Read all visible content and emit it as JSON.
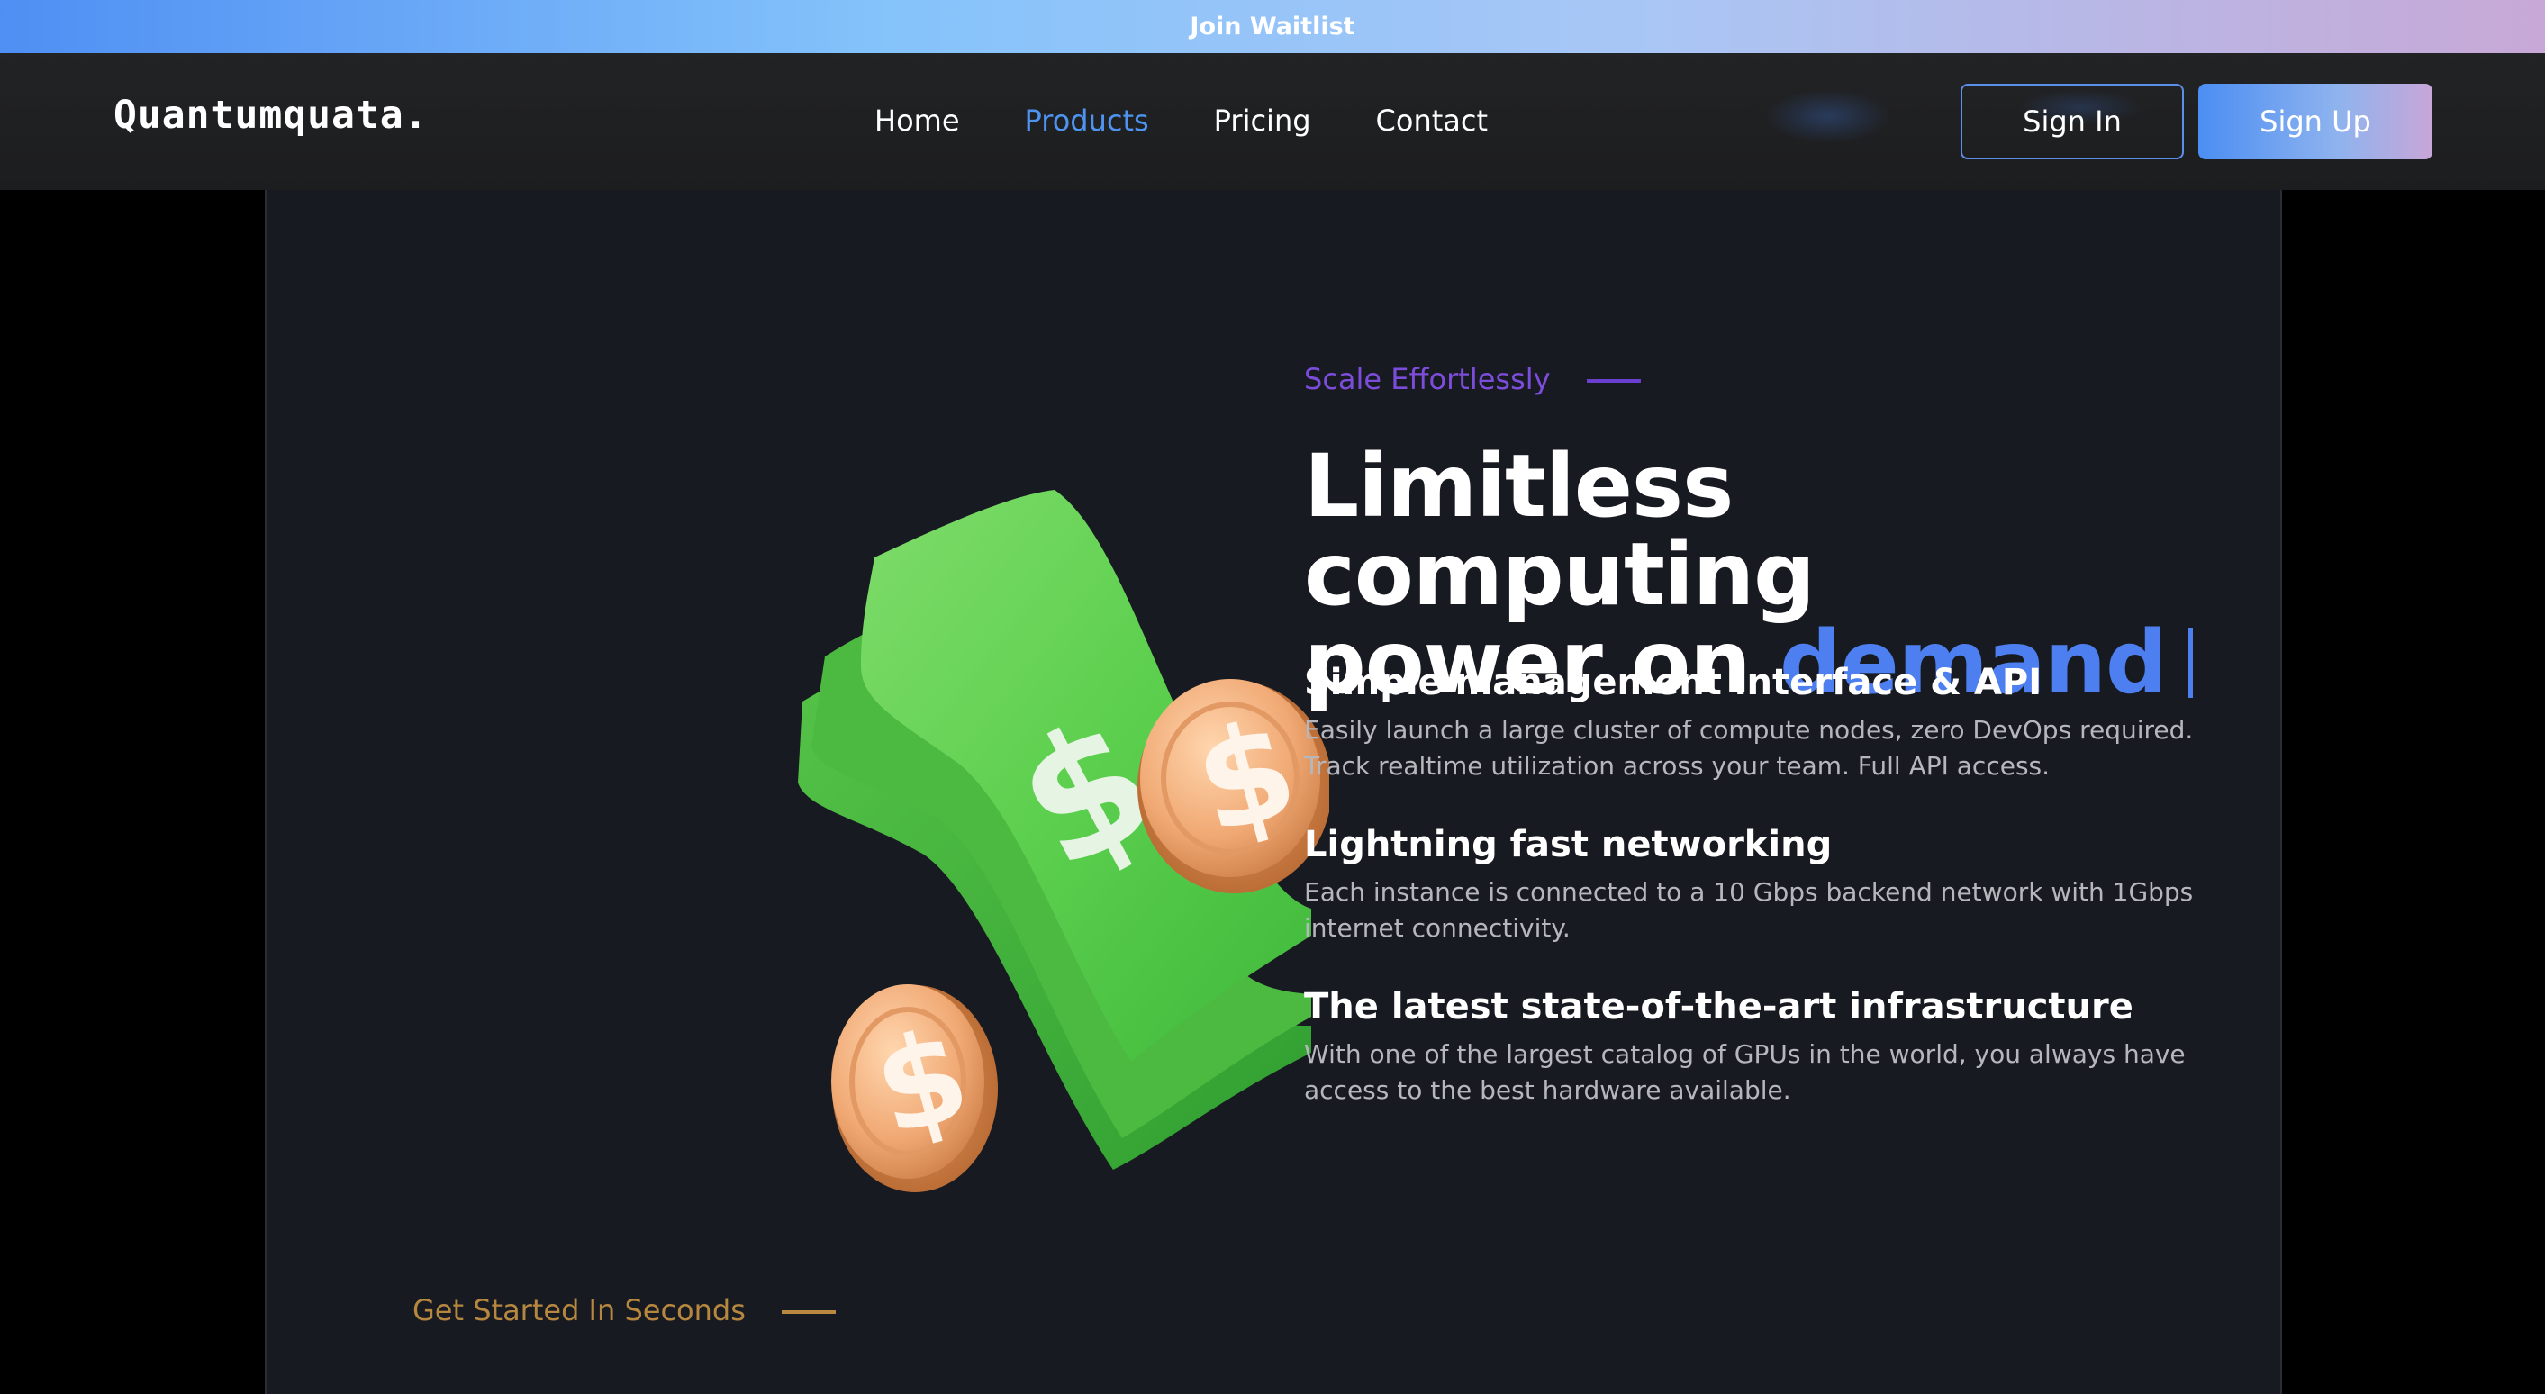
{
  "banner": {
    "label": "Join Waitlist"
  },
  "nav": {
    "logo": "Quantumquata.",
    "items": [
      {
        "label": "Home",
        "active": false
      },
      {
        "label": "Products",
        "active": true
      },
      {
        "label": "Pricing",
        "active": false
      },
      {
        "label": "Contact",
        "active": false
      }
    ],
    "sign_in": "Sign In",
    "sign_up": "Sign Up"
  },
  "hero": {
    "eyebrow": "Scale Effortlessly",
    "headline_line1": "Limitless computing",
    "headline_line2": "power on ",
    "headline_accent": "demand",
    "illustration_icon": "money-bill-coins-icon",
    "features": [
      {
        "title": "Simple management interface & API",
        "text": "Easily launch a large cluster of compute nodes, zero DevOps required. Track realtime utilization across your team. Full API access."
      },
      {
        "title": "Lightning fast networking",
        "text": "Each instance is connected to a 10 Gbps backend network with 1Gbps internet connectivity."
      },
      {
        "title": "The latest state-of-the-art infrastructure",
        "text": "With one of the largest catalog of GPUs in the world, you always have access to the best hardware available."
      }
    ]
  },
  "next_section": {
    "eyebrow": "Get Started In Seconds"
  },
  "colors": {
    "accent_blue": "#4d7ff0",
    "eyebrow_purple": "#7c4ddb",
    "eyebrow_gold": "#b6873f",
    "panel_bg": "#181a21"
  }
}
